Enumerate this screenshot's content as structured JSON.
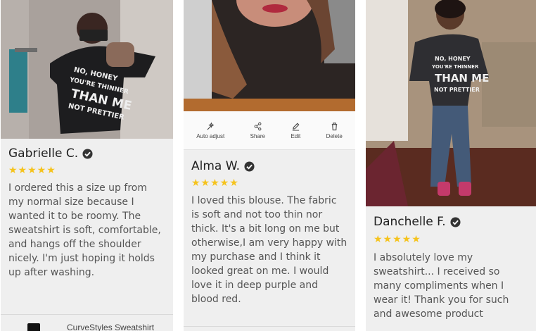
{
  "reviews": [
    {
      "name": "Gabrielle C.",
      "stars": "★★★★★",
      "text": "I ordered this a size up from my normal size because I wanted it to be roomy. The sweatshirt is soft, comfortable, and hangs off the shoulder nicely. I'm just hoping it holds up after washing.",
      "product": "CurveStyles Sweatshirt",
      "rating": 5
    },
    {
      "name": "Alma W.",
      "stars": "★★★★★",
      "text": "I loved this blouse. The fabric is soft and not too thin nor thick. It's a bit long on me but otherwise,I am very happy with my purchase and I think it looked great on me. I would love it in deep purple and blood red.",
      "rating": 5
    },
    {
      "name": "Danchelle F.",
      "stars": "★★★★★",
      "text": "I absolutely love my sweatshirt... I received so many compliments when I wear it! Thank you for such and awesome product",
      "rating": 5
    }
  ],
  "shirt_print": [
    "NO, HONEY",
    "YOU'RE THINNER",
    "THAN ME",
    "NOT PRETTIER"
  ],
  "edit_toolbar": {
    "auto_adjust": "Auto adjust",
    "share": "Share",
    "edit": "Edit",
    "delete": "Delete"
  },
  "icons": [
    "verified-check-icon",
    "auto-adjust-icon",
    "share-icon",
    "edit-icon",
    "delete-icon"
  ],
  "colors": {
    "star": "#f5c31c",
    "card_bg": "#efefef",
    "name": "#222222",
    "text": "#555555"
  }
}
